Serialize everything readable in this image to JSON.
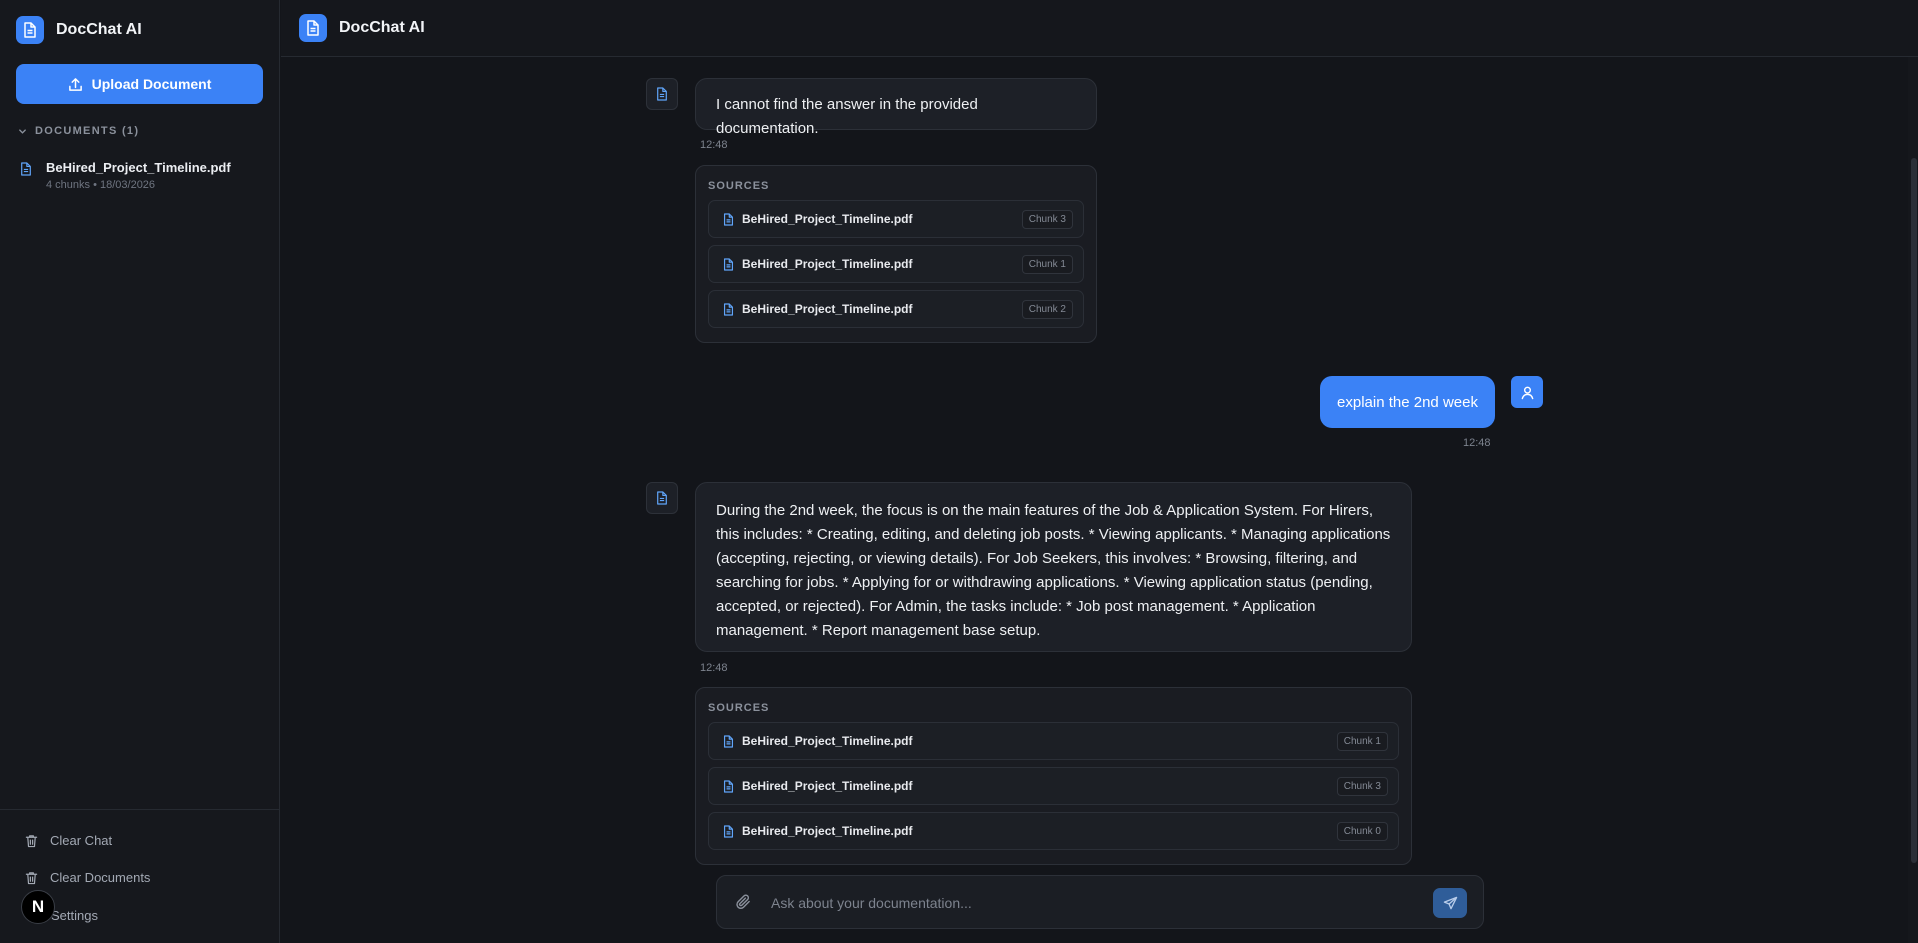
{
  "app": {
    "title": "DocChat AI"
  },
  "sidebar": {
    "upload_label": "Upload Document",
    "documents_header": "DOCUMENTS (1)",
    "documents": [
      {
        "name": "BeHired_Project_Timeline.pdf",
        "meta": "4 chunks • 18/03/2026"
      }
    ],
    "actions": {
      "clear_chat": "Clear Chat",
      "clear_documents": "Clear Documents",
      "settings": "Settings"
    },
    "badge": "N"
  },
  "chat": {
    "sources_label": "SOURCES",
    "messages": [
      {
        "role": "assistant",
        "text": "I cannot find the answer in the provided documentation.",
        "time": "12:48",
        "sources": [
          {
            "file": "BeHired_Project_Timeline.pdf",
            "chunk": "Chunk 3"
          },
          {
            "file": "BeHired_Project_Timeline.pdf",
            "chunk": "Chunk 1"
          },
          {
            "file": "BeHired_Project_Timeline.pdf",
            "chunk": "Chunk 2"
          }
        ]
      },
      {
        "role": "user",
        "text": "explain the 2nd week",
        "time": "12:48"
      },
      {
        "role": "assistant",
        "text": "During the 2nd week, the focus is on the main features of the Job & Application System. For Hirers, this includes: * Creating, editing, and deleting job posts. * Viewing applicants. * Managing applications (accepting, rejecting, or viewing details). For Job Seekers, this involves: * Browsing, filtering, and searching for jobs. * Applying for or withdrawing applications. * Viewing application status (pending, accepted, or rejected). For Admin, the tasks include: * Job post management. * Application management. * Report management base setup.",
        "time": "12:48",
        "sources": [
          {
            "file": "BeHired_Project_Timeline.pdf",
            "chunk": "Chunk 1"
          },
          {
            "file": "BeHired_Project_Timeline.pdf",
            "chunk": "Chunk 3"
          },
          {
            "file": "BeHired_Project_Timeline.pdf",
            "chunk": "Chunk 0"
          }
        ]
      }
    ]
  },
  "composer": {
    "placeholder": "Ask about your documentation..."
  }
}
